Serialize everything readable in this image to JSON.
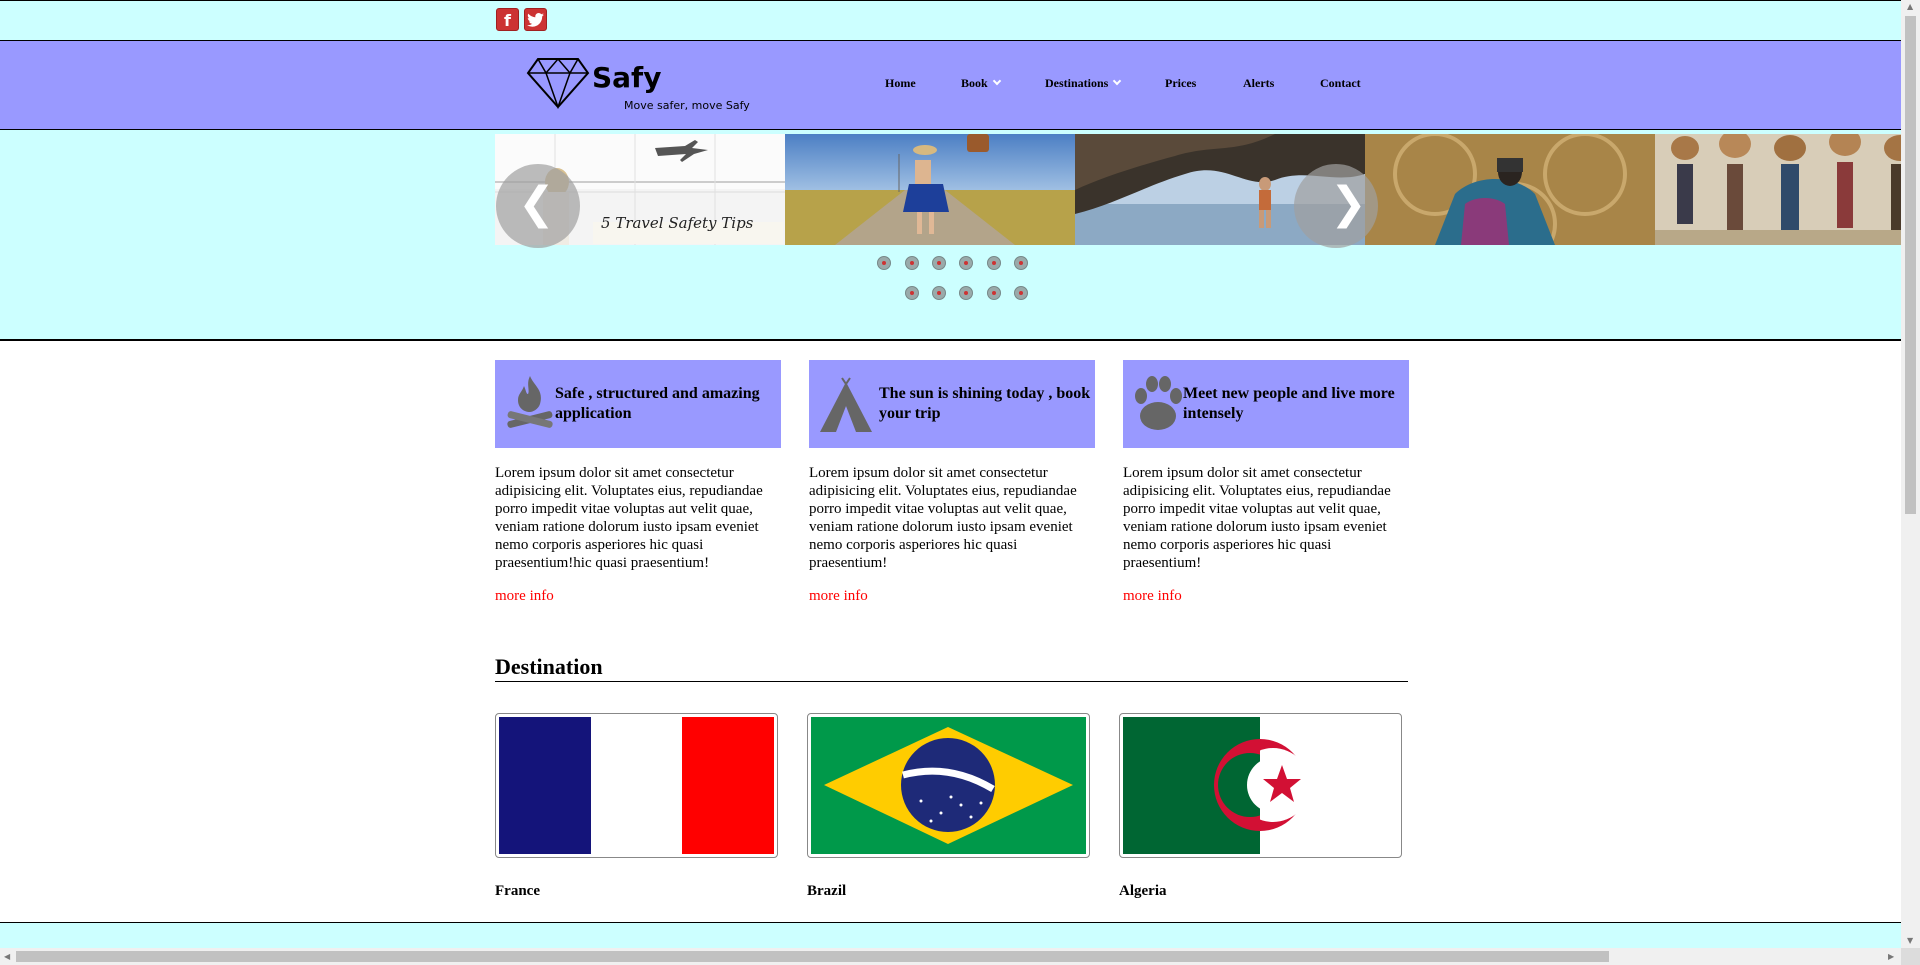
{
  "social": {
    "facebook_glyph": "f",
    "twitter_glyph": "t"
  },
  "logo": {
    "name": "Safy",
    "tagline": "Move safer, move Safy",
    "icon": "diamond-icon"
  },
  "nav": [
    {
      "label": "Home",
      "dropdown": false
    },
    {
      "label": "Book",
      "dropdown": true
    },
    {
      "label": "Destinations",
      "dropdown": true
    },
    {
      "label": "Prices",
      "dropdown": false
    },
    {
      "label": "Alerts",
      "dropdown": false
    },
    {
      "label": "Contact",
      "dropdown": false
    }
  ],
  "slider": {
    "caption": "5 Travel Safety Tips",
    "prev_glyph": "❮",
    "next_glyph": "❯"
  },
  "features": [
    {
      "title": "Safe , structured and amazing application",
      "icon": "campfire-icon",
      "text": "Lorem ipsum dolor sit amet consectetur adipisicing elit. Voluptates eius, repudiandae porro impedit vitae voluptas aut velit quae, veniam ratione dolorum iusto ipsam eveniet nemo corporis asperiores hic quasi praesentium!hic quasi praesentium!",
      "link": "more info"
    },
    {
      "title": "The sun is shining today , book your trip",
      "icon": "tent-icon",
      "text": "Lorem ipsum dolor sit amet consectetur adipisicing elit. Voluptates eius, repudiandae porro impedit vitae voluptas aut velit quae, veniam ratione dolorum iusto ipsam eveniet nemo corporis asperiores hic quasi praesentium!",
      "link": "more info"
    },
    {
      "title": "Meet new people and live more intensely",
      "icon": "paw-icon",
      "text": "Lorem ipsum dolor sit amet consectetur adipisicing elit. Voluptates eius, repudiandae porro impedit vitae voluptas aut velit quae, veniam ratione dolorum iusto ipsam eveniet nemo corporis asperiores hic quasi praesentium!",
      "link": "more info"
    }
  ],
  "destinations": {
    "heading": "Destination",
    "items": [
      {
        "name": "France",
        "flag": "flag-france"
      },
      {
        "name": "Brazil",
        "flag": "flag-brazil"
      },
      {
        "name": "Algeria",
        "flag": "flag-algeria"
      }
    ]
  },
  "colors": {
    "light_cyan": "#ccffff",
    "periwinkle": "#9999ff",
    "link_red": "#ff0000"
  }
}
